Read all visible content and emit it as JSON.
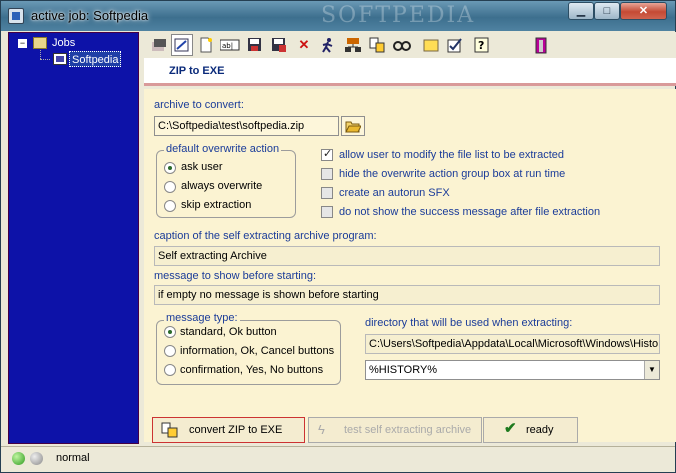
{
  "window": {
    "title": "active job: Softpedia",
    "watermark": "SOFTPEDIA"
  },
  "tree": {
    "root": "Jobs",
    "child": "Softpedia"
  },
  "toolbar": {
    "icons": [
      "new-job-icon",
      "edit-job-icon",
      "new-file-icon",
      "rename-icon",
      "save-icon",
      "save-as-icon",
      "delete-icon",
      "run-icon",
      "network-icon",
      "convert-icon",
      "view-icon",
      "folder-icon",
      "check-icon",
      "help-icon",
      "exit-icon"
    ]
  },
  "panel": {
    "title": "ZIP to EXE"
  },
  "archive": {
    "label": "archive to convert:",
    "value": "C:\\Softpedia\\test\\softpedia.zip"
  },
  "overwrite": {
    "title": "default overwrite action",
    "options": [
      "ask user",
      "always overwrite",
      "skip extraction"
    ],
    "selected": 0
  },
  "checks": [
    {
      "label": "allow user to modify the file list to be extracted",
      "checked": true
    },
    {
      "label": "hide the overwrite action group box at run time",
      "checked": false
    },
    {
      "label": "create an autorun SFX",
      "checked": false
    },
    {
      "label": "do not show the success message after file extraction",
      "checked": false
    }
  ],
  "caption": {
    "label": "caption of the self extracting archive program:",
    "value": "Self extracting Archive"
  },
  "message": {
    "label": "message to show before starting:",
    "value": "if empty no message is shown before starting"
  },
  "msgtype": {
    "title": "message type:",
    "options": [
      "standard, Ok button",
      "information, Ok, Cancel buttons",
      "confirmation, Yes, No buttons"
    ],
    "selected": 0
  },
  "directory": {
    "label": "directory that will be used when extracting:",
    "value": "C:\\Users\\Softpedia\\Appdata\\Local\\Microsoft\\Windows\\Histo",
    "selected": "%HISTORY%"
  },
  "buttons": {
    "convert": "convert ZIP to EXE",
    "test": "test self extracting archive",
    "ready": "ready"
  },
  "status": {
    "text": "normal"
  }
}
